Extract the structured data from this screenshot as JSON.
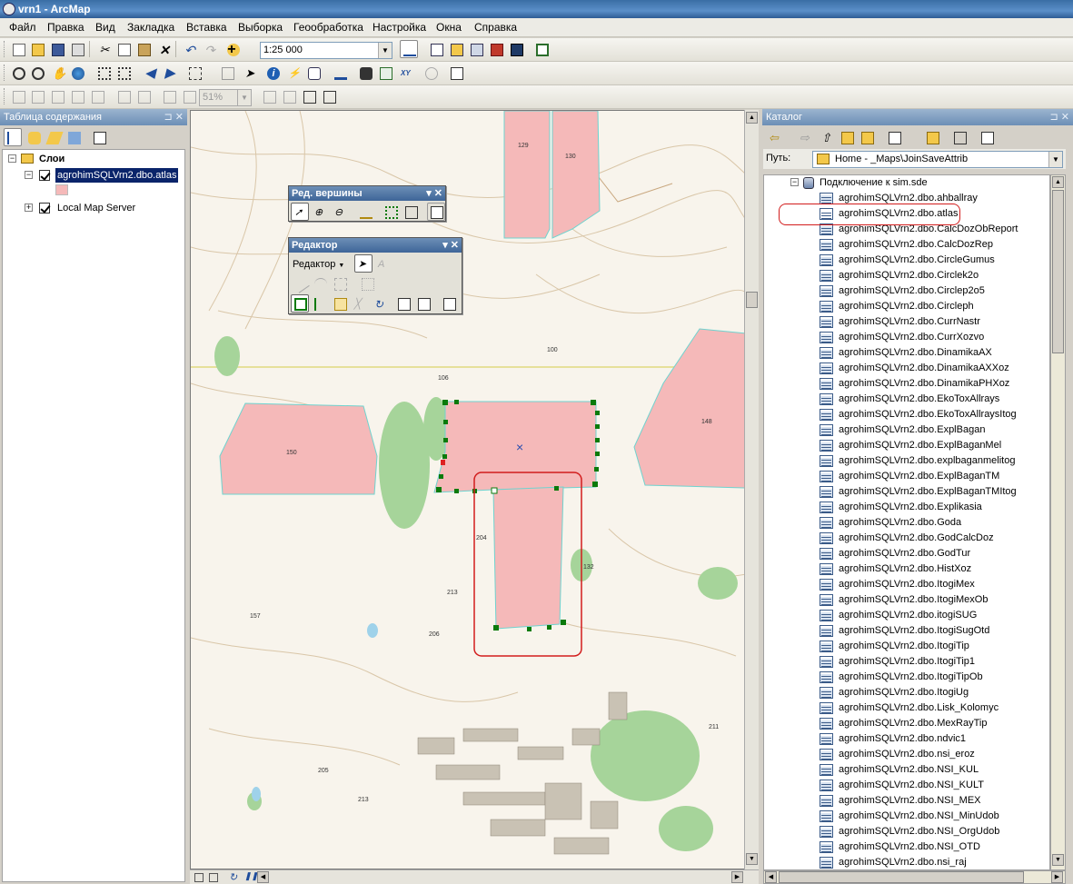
{
  "window": {
    "title": "vrn1 - ArcMap"
  },
  "menu": [
    "Файл",
    "Правка",
    "Вид",
    "Закладка",
    "Вставка",
    "Выборка",
    "Геообработка",
    "Настройка",
    "Окна",
    "Справка"
  ],
  "toolbar": {
    "scale": "1:25 000",
    "zoom_percent": "51%"
  },
  "toc": {
    "title": "Таблица содержания",
    "root": "Слои",
    "layer": "agrohimSQLVrn2.dbo.atlas",
    "layer2": "Local Map Server"
  },
  "vertex_toolbar": {
    "title": "Ред. вершины"
  },
  "editor_toolbar": {
    "title": "Редактор",
    "menu": "Редактор"
  },
  "map": {
    "labels": [
      "129",
      "130",
      "150",
      "148",
      "106",
      "100",
      "213",
      "206",
      "157",
      "211",
      "213",
      "204",
      "132",
      "205"
    ]
  },
  "catalog": {
    "title": "Каталог",
    "path_label": "Путь:",
    "path": "Home - _Maps\\JoinSaveAttrib",
    "connection": "Подключение к sim.sde",
    "items": [
      "agrohimSQLVrn2.dbo.ahballray",
      "agrohimSQLVrn2.dbo.atlas",
      "agrohimSQLVrn2.dbo.CalcDozObReport",
      "agrohimSQLVrn2.dbo.CalcDozRep",
      "agrohimSQLVrn2.dbo.CircleGumus",
      "agrohimSQLVrn2.dbo.Circlek2o",
      "agrohimSQLVrn2.dbo.Circlep2o5",
      "agrohimSQLVrn2.dbo.Circleph",
      "agrohimSQLVrn2.dbo.CurrNastr",
      "agrohimSQLVrn2.dbo.CurrXozvo",
      "agrohimSQLVrn2.dbo.DinamikaAX",
      "agrohimSQLVrn2.dbo.DinamikaAXXoz",
      "agrohimSQLVrn2.dbo.DinamikaPHXoz",
      "agrohimSQLVrn2.dbo.EkoToxAllrays",
      "agrohimSQLVrn2.dbo.EkoToxAllraysItog",
      "agrohimSQLVrn2.dbo.ExplBagan",
      "agrohimSQLVrn2.dbo.ExplBaganMel",
      "agrohimSQLVrn2.dbo.explbaganmelitog",
      "agrohimSQLVrn2.dbo.ExplBaganTM",
      "agrohimSQLVrn2.dbo.ExplBaganTMItog",
      "agrohimSQLVrn2.dbo.Explikasia",
      "agrohimSQLVrn2.dbo.Goda",
      "agrohimSQLVrn2.dbo.GodCalcDoz",
      "agrohimSQLVrn2.dbo.GodTur",
      "agrohimSQLVrn2.dbo.HistXoz",
      "agrohimSQLVrn2.dbo.ItogiMex",
      "agrohimSQLVrn2.dbo.ItogiMexOb",
      "agrohimSQLVrn2.dbo.itogiSUG",
      "agrohimSQLVrn2.dbo.ItogiSugOtd",
      "agrohimSQLVrn2.dbo.ItogiTip",
      "agrohimSQLVrn2.dbo.ItogiTip1",
      "agrohimSQLVrn2.dbo.ItogiTipOb",
      "agrohimSQLVrn2.dbo.ItogiUg",
      "agrohimSQLVrn2.dbo.Lisk_Kolomyc",
      "agrohimSQLVrn2.dbo.MexRayTip",
      "agrohimSQLVrn2.dbo.ndvic1",
      "agrohimSQLVrn2.dbo.nsi_eroz",
      "agrohimSQLVrn2.dbo.NSI_KUL",
      "agrohimSQLVrn2.dbo.NSI_KULT",
      "agrohimSQLVrn2.dbo.NSI_MEX",
      "agrohimSQLVrn2.dbo.NSI_MinUdob",
      "agrohimSQLVrn2.dbo.NSI_OrgUdob",
      "agrohimSQLVrn2.dbo.NSI_OTD",
      "agrohimSQLVrn2.dbo.nsi_raj"
    ]
  }
}
